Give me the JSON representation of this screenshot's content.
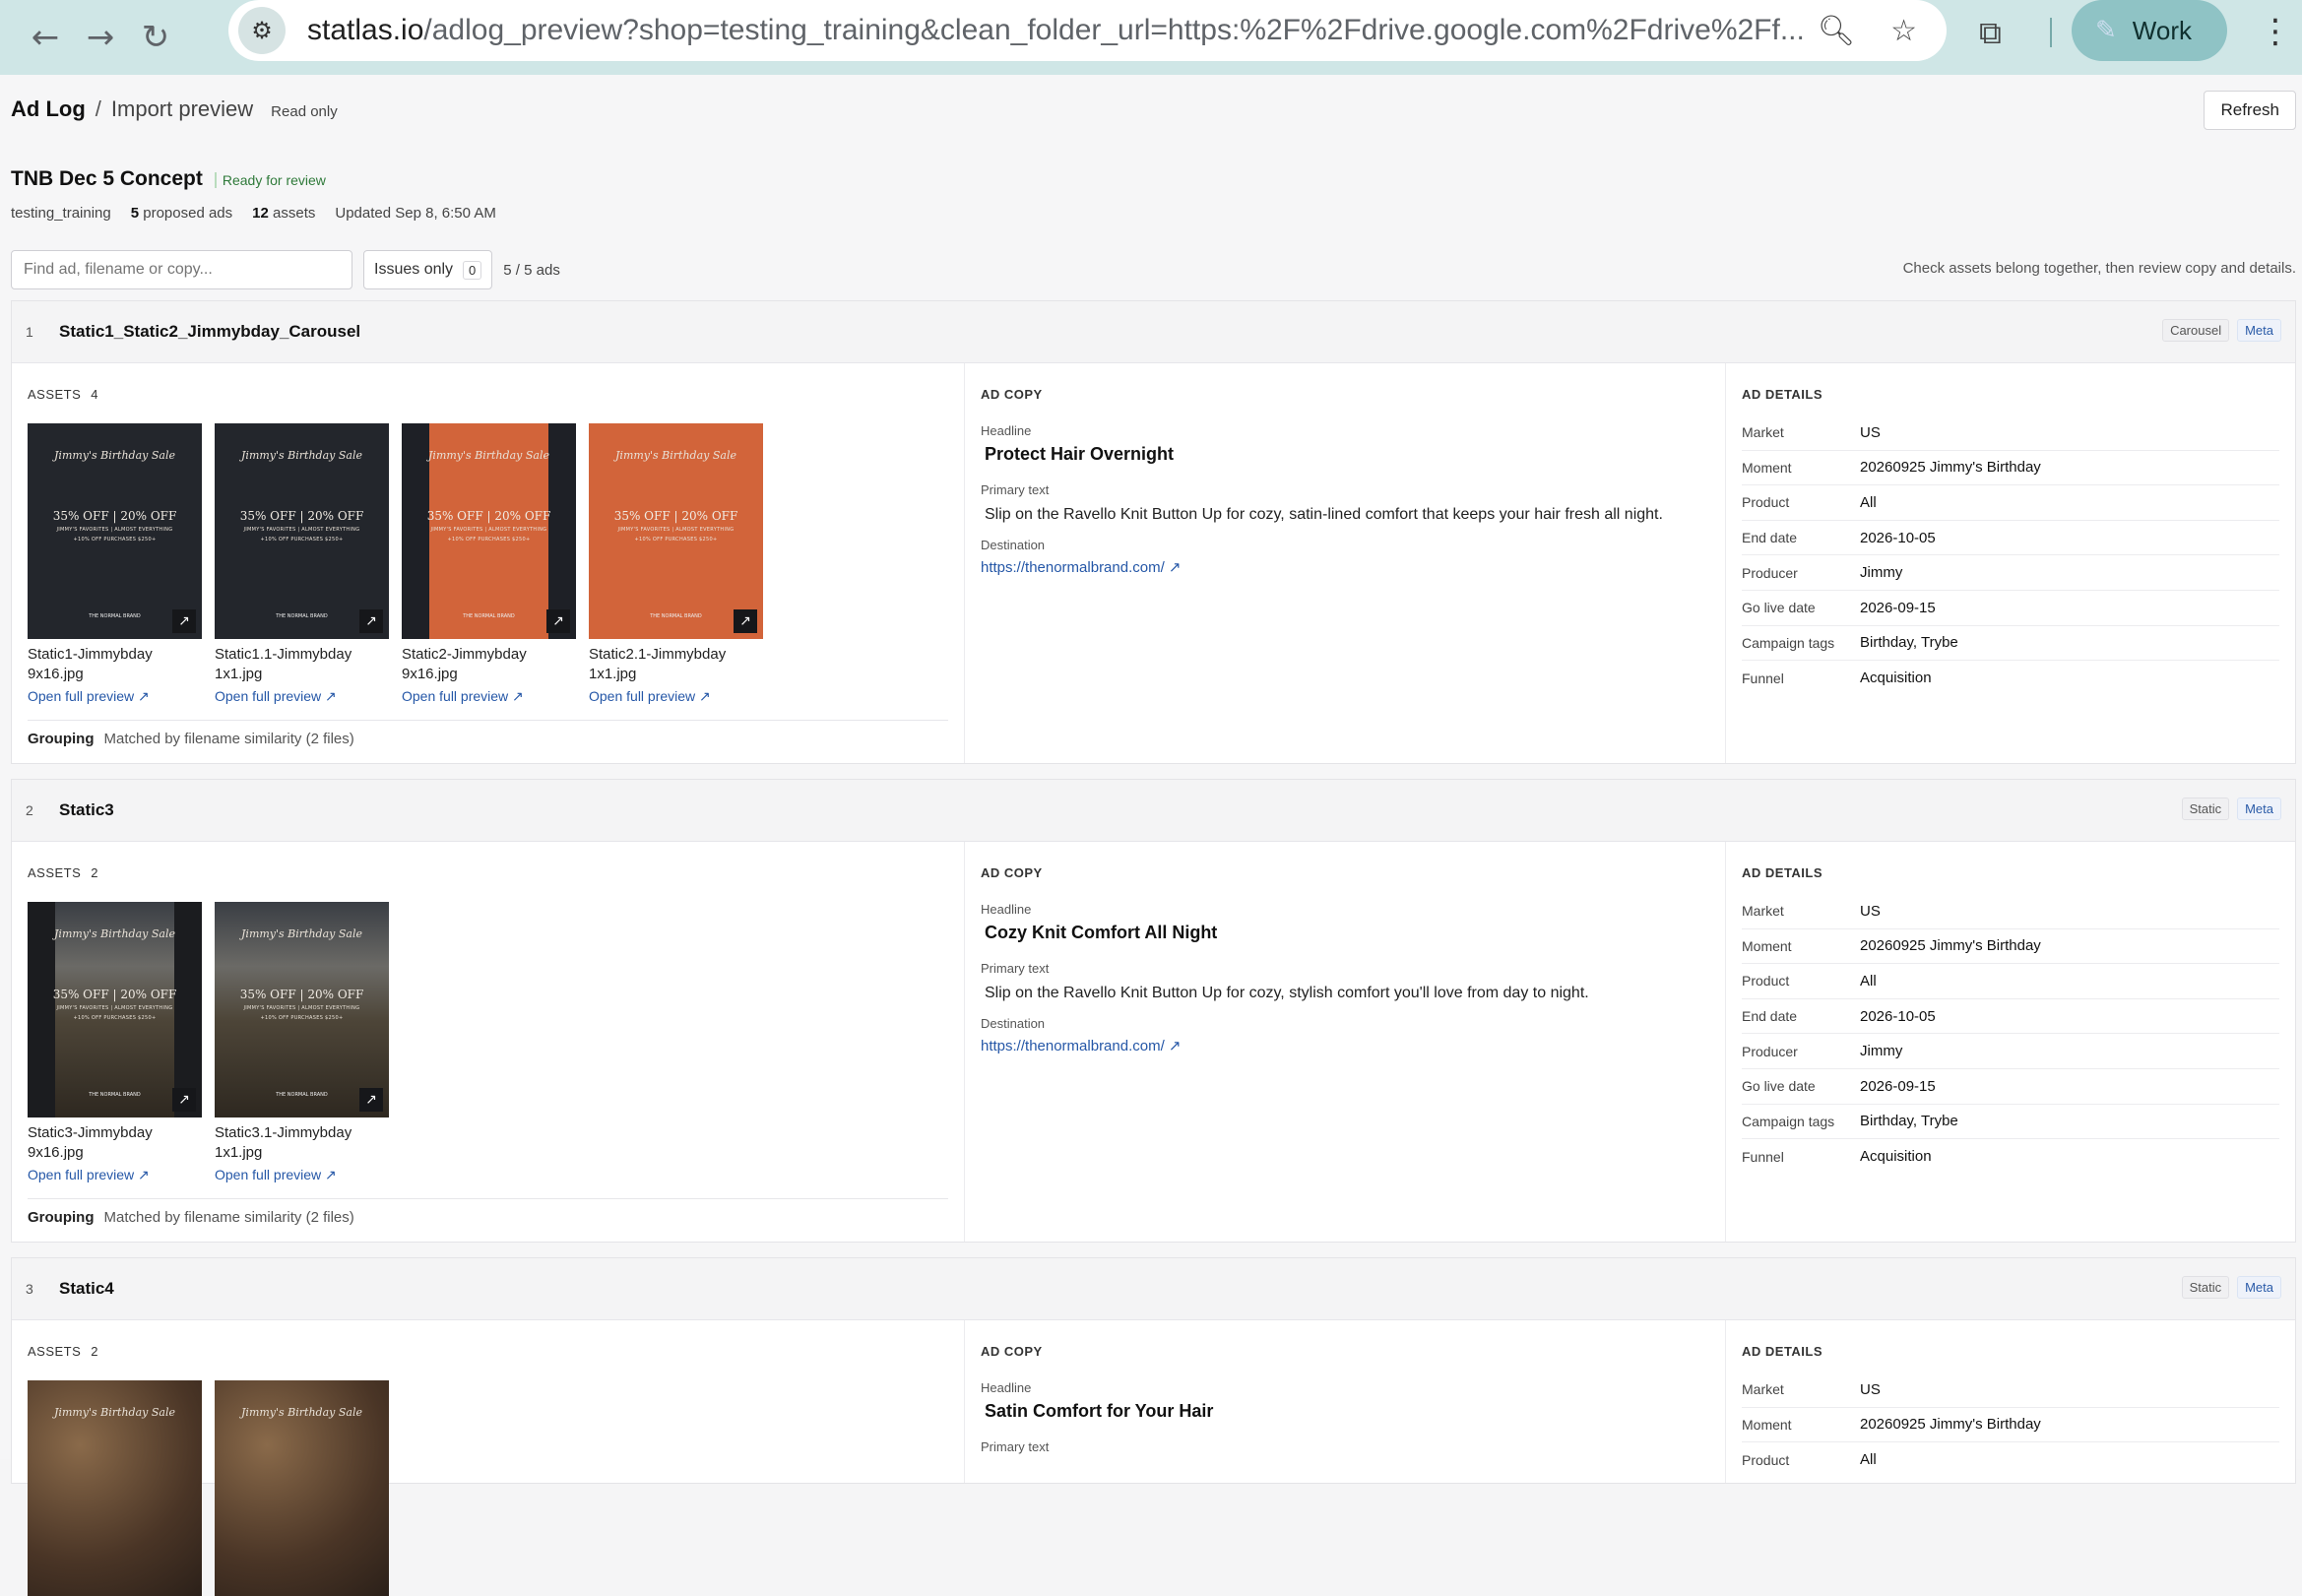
{
  "browser": {
    "url_host": "statlas.io",
    "url_path": "/adlog_preview?shop=testing_training&clean_folder_url=https:%2F%2Fdrive.google.com%2Fdrive%2Ff...",
    "profile_label": "Work"
  },
  "header": {
    "crumb_root": "Ad Log",
    "crumb_sep": "/",
    "crumb_current": "Import preview",
    "readonly": "Read only",
    "refresh_label": "Refresh"
  },
  "concept": {
    "title": "TNB Dec 5 Concept",
    "status": "Ready for review",
    "shop": "testing_training",
    "proposed_count": "5",
    "proposed_label": "proposed ads",
    "assets_count": "12",
    "assets_label": "assets",
    "updated": "Updated Sep 8, 6:50 AM"
  },
  "filters": {
    "search_placeholder": "Find ad, filename or copy...",
    "issues_label": "Issues only",
    "issues_count": "0",
    "ads_count": "5 / 5 ads",
    "hint": "Check assets belong together, then review copy and details."
  },
  "labels": {
    "assets": "ASSETS",
    "ad_copy": "AD COPY",
    "ad_details": "AD DETAILS",
    "headline": "Headline",
    "primary_text": "Primary text",
    "destination": "Destination",
    "grouping": "Grouping",
    "open_preview": "Open full preview ↗"
  },
  "ads": [
    {
      "num": "1",
      "name": "Static1_Static2_Jimmybday_Carousel",
      "type_tag": "Carousel",
      "platform_tag": "Meta",
      "asset_count": "4",
      "assets": [
        {
          "file": "Static1-Jimmybday 9x16.jpg",
          "script": "Jimmy's Birthday Sale",
          "offer": "35% OFF | 20% OFF",
          "sub": "JIMMY'S FAVORITES | ALMOST EVERYTHING",
          "extra": "+10% OFF PURCHASES $250+",
          "brand": "THE NORMAL BRAND"
        },
        {
          "file": "Static1.1-Jimmybday 1x1.jpg",
          "script": "Jimmy's Birthday Sale",
          "offer": "35% OFF | 20% OFF",
          "sub": "JIMMY'S FAVORITES | ALMOST EVERYTHING",
          "extra": "+10% OFF PURCHASES $250+",
          "brand": "THE NORMAL BRAND"
        },
        {
          "file": "Static2-Jimmybday 9x16.jpg",
          "script": "Jimmy's Birthday Sale",
          "offer": "35% OFF | 20% OFF",
          "sub": "JIMMY'S FAVORITES | ALMOST EVERYTHING",
          "extra": "+10% OFF PURCHASES $250+",
          "brand": "THE NORMAL BRAND"
        },
        {
          "file": "Static2.1-Jimmybday 1x1.jpg",
          "script": "Jimmy's Birthday Sale",
          "offer": "35% OFF | 20% OFF",
          "sub": "JIMMY'S FAVORITES | ALMOST EVERYTHING",
          "extra": "+10% OFF PURCHASES $250+",
          "brand": "THE NORMAL BRAND"
        }
      ],
      "grouping": "Matched by filename similarity (2 files)",
      "headline": "Protect Hair Overnight",
      "primary": "Slip on the Ravello Knit Button Up for cozy, satin-lined comfort that keeps your hair fresh all night.",
      "destination": "https://thenormalbrand.com/ ↗",
      "details": [
        {
          "k": "Market",
          "v": "US"
        },
        {
          "k": "Moment",
          "v": "20260925 Jimmy's Birthday"
        },
        {
          "k": "Product",
          "v": "All"
        },
        {
          "k": "End date",
          "v": "2026-10-05"
        },
        {
          "k": "Producer",
          "v": "Jimmy"
        },
        {
          "k": "Go live date",
          "v": "2026-09-15"
        },
        {
          "k": "Campaign tags",
          "v": "Birthday, Trybe"
        },
        {
          "k": "Funnel",
          "v": "Acquisition"
        }
      ]
    },
    {
      "num": "2",
      "name": "Static3",
      "type_tag": "Static",
      "platform_tag": "Meta",
      "asset_count": "2",
      "assets": [
        {
          "file": "Static3-Jimmybday 9x16.jpg",
          "script": "Jimmy's Birthday Sale",
          "offer": "35% OFF | 20% OFF",
          "sub": "JIMMY'S FAVORITES | ALMOST EVERYTHING",
          "extra": "+10% OFF PURCHASES $250+",
          "brand": "THE NORMAL BRAND"
        },
        {
          "file": "Static3.1-Jimmybday 1x1.jpg",
          "script": "Jimmy's Birthday Sale",
          "offer": "35% OFF | 20% OFF",
          "sub": "JIMMY'S FAVORITES | ALMOST EVERYTHING",
          "extra": "+10% OFF PURCHASES $250+",
          "brand": "THE NORMAL BRAND"
        }
      ],
      "grouping": "Matched by filename similarity (2 files)",
      "headline": "Cozy Knit Comfort All Night",
      "primary": "Slip on the Ravello Knit Button Up for cozy, stylish comfort you'll love from day to night.",
      "destination": "https://thenormalbrand.com/ ↗",
      "details": [
        {
          "k": "Market",
          "v": "US"
        },
        {
          "k": "Moment",
          "v": "20260925 Jimmy's Birthday"
        },
        {
          "k": "Product",
          "v": "All"
        },
        {
          "k": "End date",
          "v": "2026-10-05"
        },
        {
          "k": "Producer",
          "v": "Jimmy"
        },
        {
          "k": "Go live date",
          "v": "2026-09-15"
        },
        {
          "k": "Campaign tags",
          "v": "Birthday, Trybe"
        },
        {
          "k": "Funnel",
          "v": "Acquisition"
        }
      ]
    },
    {
      "num": "3",
      "name": "Static4",
      "type_tag": "Static",
      "platform_tag": "Meta",
      "asset_count": "2",
      "assets": [
        {
          "script": "Jimmy's Birthday Sale"
        },
        {
          "script": "Jimmy's Birthday Sale"
        }
      ],
      "headline": "Satin Comfort for Your Hair",
      "details": [
        {
          "k": "Market",
          "v": "US"
        },
        {
          "k": "Moment",
          "v": "20260925 Jimmy's Birthday"
        },
        {
          "k": "Product",
          "v": "All"
        }
      ]
    }
  ]
}
